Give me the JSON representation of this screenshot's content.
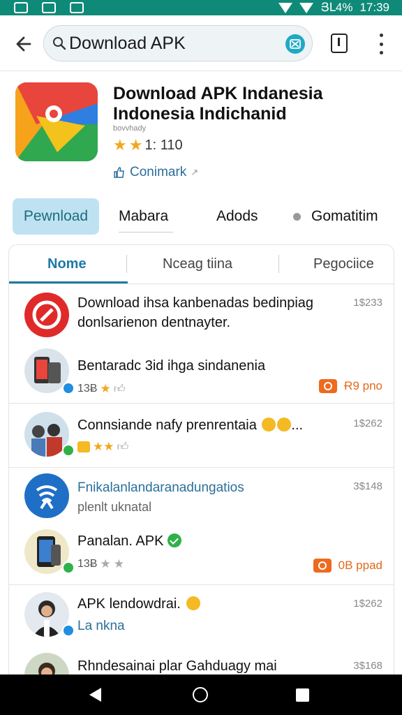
{
  "status_bar": {
    "battery": "ՅԼ4%",
    "time": "17:39"
  },
  "search": {
    "query": "Download APK"
  },
  "app": {
    "title_line1": "Download APK Indanesia",
    "title_line2": "Indonesia Indichanid",
    "developer": "bovvhady",
    "rating": "1: 110",
    "community": "Conimark"
  },
  "actions": {
    "download": "Pewnload",
    "mabara": "Mabara",
    "adods": "Adods",
    "gomatitim": "Gomatitim"
  },
  "tabs": [
    "Nome",
    "Nceag tiina",
    "Pegociice"
  ],
  "colors": {
    "accent": "#1d7aa6",
    "status_bar": "#0f8a78",
    "orange": "#ee6a1e"
  },
  "rows": [
    {
      "title": "Download ihsa kanbenadas bedinpiag",
      "sub": "donlsarienon dentnayter.",
      "right": "1$233"
    },
    {
      "title": "Bentaradc 3id ihga sindanenia",
      "meta": "13Ƀ",
      "badge": "Ɍ9 pno"
    },
    {
      "title": "Connsiande nafy prenrentaia",
      "right": "1$262"
    },
    {
      "title": "Fnikalanlandaranadungatios",
      "sub": "plenlt uknatal",
      "right": "3$148"
    },
    {
      "title": "Panalan. APK",
      "meta": "13Ƀ",
      "badge": "0B ppad"
    },
    {
      "title": "APK lendowdrai.",
      "sub": "La nkna",
      "right": "1$262"
    },
    {
      "title": "Rhndesainai plar Gahduagy mai",
      "right": "3$168"
    }
  ]
}
